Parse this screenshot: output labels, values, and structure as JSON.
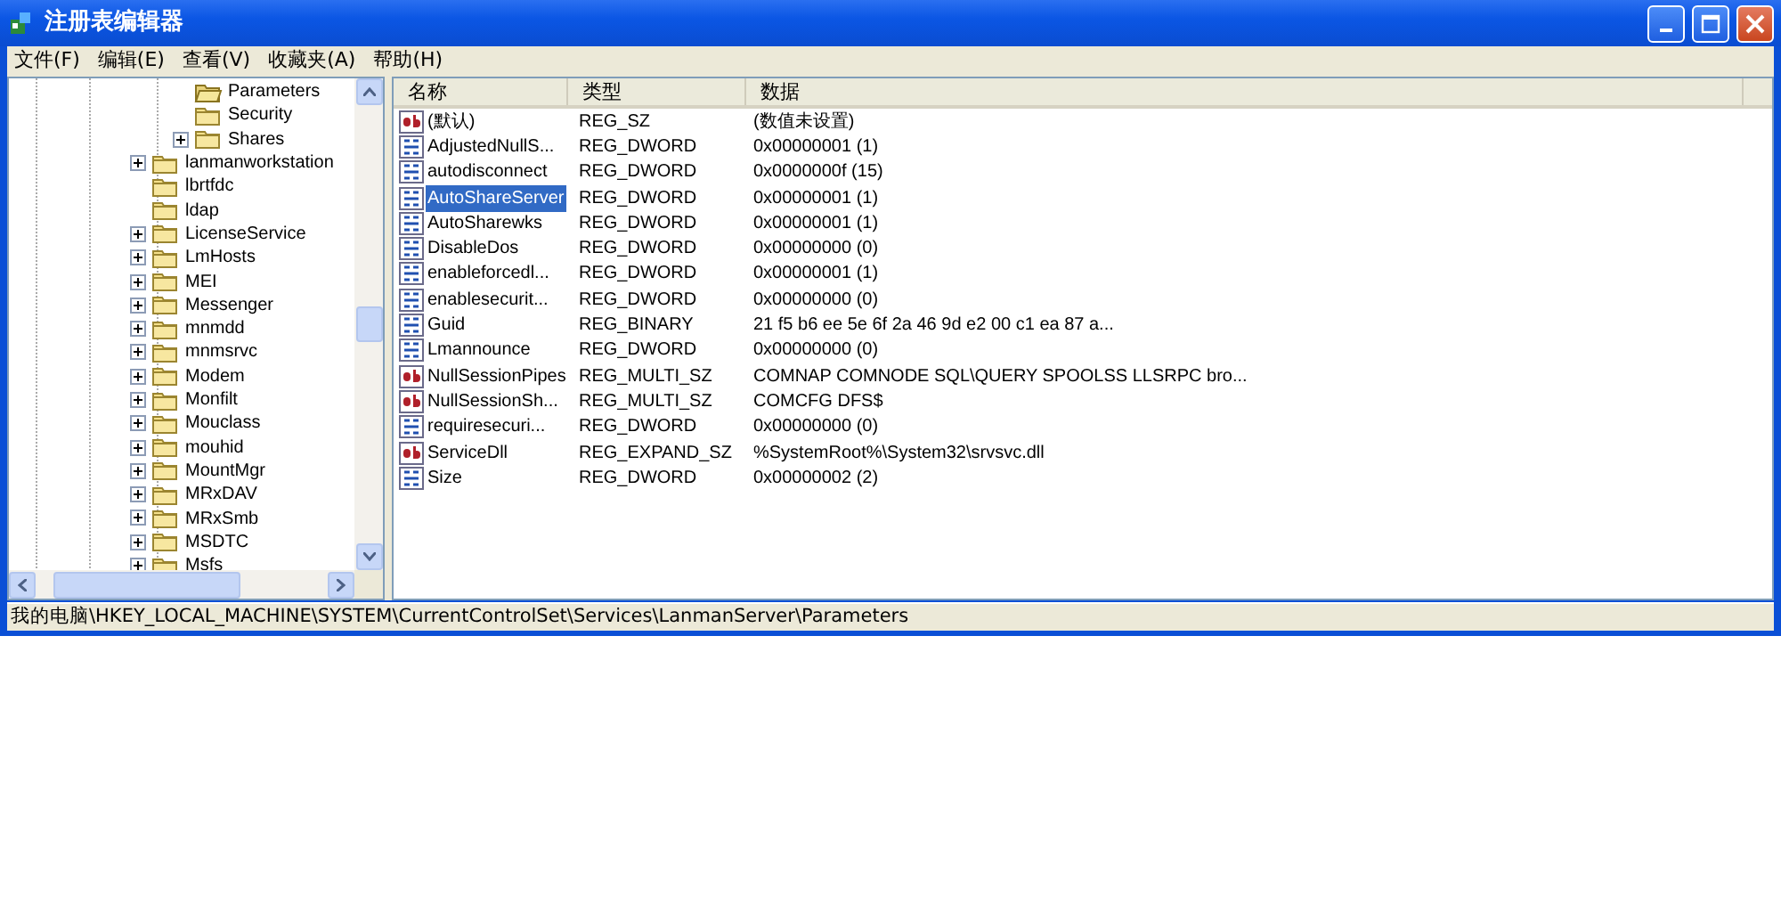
{
  "window": {
    "title": "注册表编辑器"
  },
  "menu": [
    "文件(F)",
    "编辑(E)",
    "查看(V)",
    "收藏夹(A)",
    "帮助(H)"
  ],
  "tree": {
    "partial_children": [
      {
        "label": "Parameters",
        "expandable": false,
        "open": true
      },
      {
        "label": "Security",
        "expandable": false,
        "open": false
      },
      {
        "label": "Shares",
        "expandable": true,
        "open": false
      }
    ],
    "items": [
      {
        "label": "lanmanworkstation",
        "expandable": true,
        "open": false
      },
      {
        "label": "lbrtfdc",
        "expandable": false,
        "open": false
      },
      {
        "label": "ldap",
        "expandable": false,
        "open": false
      },
      {
        "label": "LicenseService",
        "expandable": true,
        "open": false
      },
      {
        "label": "LmHosts",
        "expandable": true,
        "open": false
      },
      {
        "label": "MEI",
        "expandable": true,
        "open": false
      },
      {
        "label": "Messenger",
        "expandable": true,
        "open": false
      },
      {
        "label": "mnmdd",
        "expandable": true,
        "open": false
      },
      {
        "label": "mnmsrvc",
        "expandable": true,
        "open": false
      },
      {
        "label": "Modem",
        "expandable": true,
        "open": false
      },
      {
        "label": "Monfilt",
        "expandable": true,
        "open": false
      },
      {
        "label": "Mouclass",
        "expandable": true,
        "open": false
      },
      {
        "label": "mouhid",
        "expandable": true,
        "open": false
      },
      {
        "label": "MountMgr",
        "expandable": true,
        "open": false
      },
      {
        "label": "MRxDAV",
        "expandable": true,
        "open": false
      },
      {
        "label": "MRxSmb",
        "expandable": true,
        "open": false
      },
      {
        "label": "MSDTC",
        "expandable": true,
        "open": false
      },
      {
        "label": "Msfs",
        "expandable": true,
        "open": false
      }
    ]
  },
  "values": {
    "columns": [
      "名称",
      "类型",
      "数据"
    ],
    "rows": [
      {
        "kind": "string",
        "name": "(默认)",
        "type": "REG_SZ",
        "data": "(数值未设置)",
        "selected": false
      },
      {
        "kind": "binary",
        "name": "AdjustedNullS...",
        "type": "REG_DWORD",
        "data": "0x00000001 (1)",
        "selected": false
      },
      {
        "kind": "binary",
        "name": "autodisconnect",
        "type": "REG_DWORD",
        "data": "0x0000000f (15)",
        "selected": false
      },
      {
        "kind": "binary",
        "name": "AutoShareServer",
        "type": "REG_DWORD",
        "data": "0x00000001 (1)",
        "selected": true
      },
      {
        "kind": "binary",
        "name": "AutoSharewks",
        "type": "REG_DWORD",
        "data": "0x00000001 (1)",
        "selected": false
      },
      {
        "kind": "binary",
        "name": "DisableDos",
        "type": "REG_DWORD",
        "data": "0x00000000 (0)",
        "selected": false
      },
      {
        "kind": "binary",
        "name": "enableforcedl...",
        "type": "REG_DWORD",
        "data": "0x00000001 (1)",
        "selected": false
      },
      {
        "kind": "binary",
        "name": "enablesecurit...",
        "type": "REG_DWORD",
        "data": "0x00000000 (0)",
        "selected": false
      },
      {
        "kind": "binary",
        "name": "Guid",
        "type": "REG_BINARY",
        "data": "21 f5 b6 ee 5e 6f 2a 46 9d e2 00 c1 ea 87 a...",
        "selected": false
      },
      {
        "kind": "binary",
        "name": "Lmannounce",
        "type": "REG_DWORD",
        "data": "0x00000000 (0)",
        "selected": false
      },
      {
        "kind": "string",
        "name": "NullSessionPipes",
        "type": "REG_MULTI_SZ",
        "data": "COMNAP COMNODE SQL\\QUERY SPOOLSS LLSRPC bro...",
        "selected": false
      },
      {
        "kind": "string",
        "name": "NullSessionSh...",
        "type": "REG_MULTI_SZ",
        "data": "COMCFG DFS$",
        "selected": false
      },
      {
        "kind": "binary",
        "name": "requiresecuri...",
        "type": "REG_DWORD",
        "data": "0x00000000 (0)",
        "selected": false
      },
      {
        "kind": "string",
        "name": "ServiceDll",
        "type": "REG_EXPAND_SZ",
        "data": "%SystemRoot%\\System32\\srvsvc.dll",
        "selected": false
      },
      {
        "kind": "binary",
        "name": "Size",
        "type": "REG_DWORD",
        "data": "0x00000002 (2)",
        "selected": false
      }
    ]
  },
  "status_bar": "我的电脑\\HKEY_LOCAL_MACHINE\\SYSTEM\\CurrentControlSet\\Services\\LanmanServer\\Parameters"
}
